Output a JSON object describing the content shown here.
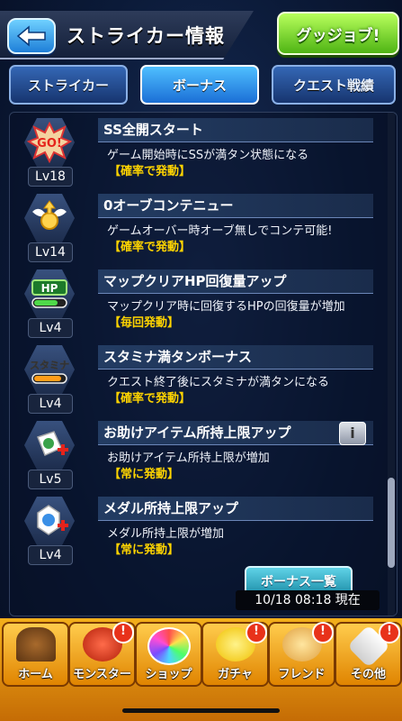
{
  "header": {
    "title": "ストライカー情報",
    "gugu_label": "グッジョブ!"
  },
  "tabs": [
    {
      "label": "ストライカー",
      "active": false
    },
    {
      "label": "ボーナス",
      "active": true
    },
    {
      "label": "クエスト戦績",
      "active": false
    }
  ],
  "bonuses": [
    {
      "icon": "go-icon",
      "icon_text": "GO!",
      "level": "Lv18",
      "title": "SS全開スタート",
      "desc": "ゲーム開始時にSSが満タン状態になる",
      "cond": "【確率で発動】",
      "info": false
    },
    {
      "icon": "orb-wings-icon",
      "icon_text": "",
      "level": "Lv14",
      "title": "0オーブコンテニュー",
      "desc": "ゲームオーバー時オーブ無しでコンテ可能!",
      "cond": "【確率で発動】",
      "info": false
    },
    {
      "icon": "hp-icon",
      "icon_text": "HP",
      "level": "Lv4",
      "title": "マップクリアHP回復量アップ",
      "desc": "マップクリア時に回復するHPの回復量が増加",
      "cond": "【毎回発動】",
      "info": false
    },
    {
      "icon": "stamina-icon",
      "icon_text": "スタミナ",
      "level": "Lv4",
      "title": "スタミナ満タンボーナス",
      "desc": "クエスト終了後にスタミナが満タンになる",
      "cond": "【確率で発動】",
      "info": false
    },
    {
      "icon": "item-plus-icon",
      "icon_text": "",
      "level": "Lv5",
      "title": "お助けアイテム所持上限アップ",
      "desc": "お助けアイテム所持上限が増加",
      "cond": "【常に発動】",
      "info": true,
      "info_label": "i"
    },
    {
      "icon": "medal-plus-icon",
      "icon_text": "",
      "level": "Lv4",
      "title": "メダル所持上限アップ",
      "desc": "メダル所持上限が増加",
      "cond": "【常に発動】",
      "info": false
    }
  ],
  "list_button": "ボーナス一覧",
  "timestamp": "10/18 08:18 現在",
  "nav": [
    {
      "label": "ホーム",
      "icon": "home-icon",
      "badge": ""
    },
    {
      "label": "モンスター",
      "icon": "monster-icon",
      "badge": "!"
    },
    {
      "label": "ショップ",
      "icon": "shop-orb-icon",
      "badge": ""
    },
    {
      "label": "ガチャ",
      "icon": "gacha-icon",
      "badge": "!"
    },
    {
      "label": "フレンド",
      "icon": "friend-icon",
      "badge": "!"
    },
    {
      "label": "その他",
      "icon": "other-icon",
      "badge": "!"
    }
  ],
  "colors": {
    "accent": "#2b7fe0",
    "condition_yellow": "#ffd400",
    "nav_orange": "#f4a81b",
    "badge_red": "#e8321a"
  }
}
